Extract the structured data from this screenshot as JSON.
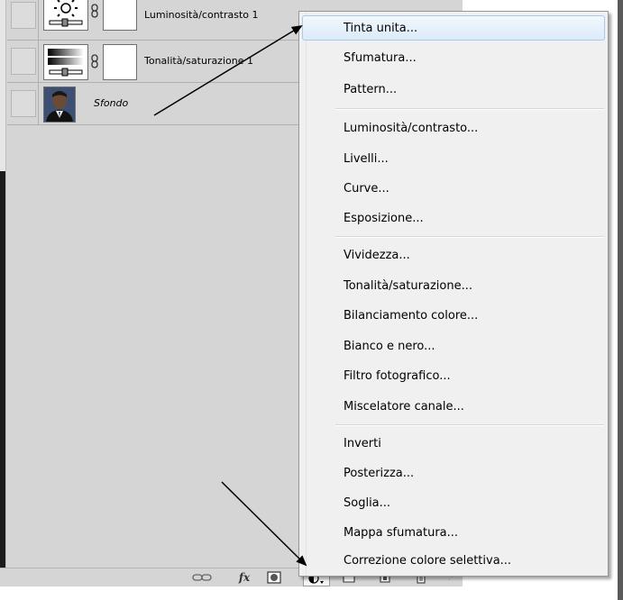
{
  "layers": [
    {
      "name": "Luminosità/contrasto 1",
      "type": "adjustment",
      "icon": "sun-icon"
    },
    {
      "name": "Tonalità/saturazione 1",
      "type": "adjustment",
      "icon": "hue-saturation-icon"
    },
    {
      "name": "Sfondo",
      "type": "photo",
      "italic": true
    }
  ],
  "menu": {
    "items": [
      {
        "label": "Tinta unita...",
        "highlighted": true
      },
      {
        "label": "Sfumatura..."
      },
      {
        "label": "Pattern..."
      },
      {
        "label": "Luminosità/contrasto..."
      },
      {
        "label": "Livelli..."
      },
      {
        "label": "Curve..."
      },
      {
        "label": "Esposizione..."
      },
      {
        "label": "Vividezza..."
      },
      {
        "label": "Tonalità/saturazione..."
      },
      {
        "label": "Bilanciamento colore..."
      },
      {
        "label": "Bianco e nero..."
      },
      {
        "label": "Filtro fotografico..."
      },
      {
        "label": "Miscelatore canale..."
      },
      {
        "label": "Inverti"
      },
      {
        "label": "Posterizza..."
      },
      {
        "label": "Soglia..."
      },
      {
        "label": "Mappa sfumatura..."
      },
      {
        "label": "Correzione colore selettiva..."
      }
    ]
  },
  "bottom_bar": {
    "icons": [
      "link-layers-icon",
      "fx-icon",
      "add-mask-icon",
      "adjustment-layer-icon",
      "new-group-icon",
      "new-layer-icon",
      "trash-icon"
    ],
    "fx_label": "fx"
  },
  "colors": {
    "panel_bg": "#d5d5d5",
    "menu_bg": "#f0f0f0",
    "highlight": "#dbebf9"
  }
}
